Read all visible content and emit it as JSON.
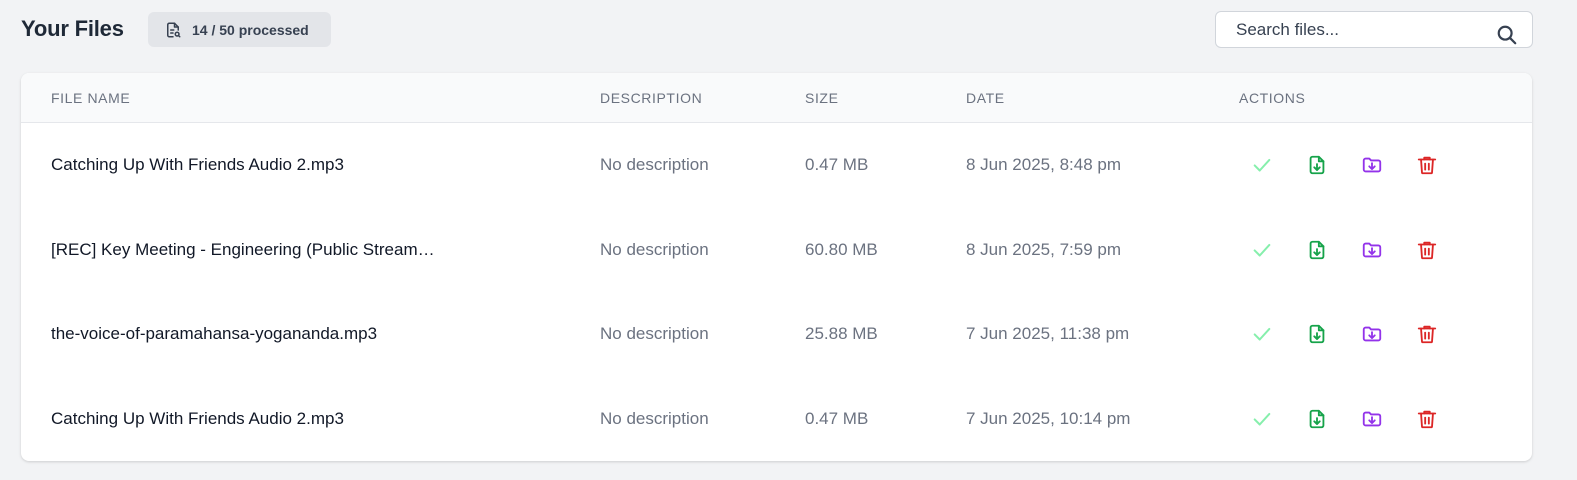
{
  "header": {
    "title": "Your Files",
    "badge": {
      "icon": "file-list-icon",
      "text": "14 / 50 processed"
    },
    "search": {
      "placeholder": "Search files...",
      "value": "",
      "icon": "search-icon"
    }
  },
  "table": {
    "columns": [
      "File Name",
      "Description",
      "Size",
      "Date",
      "Actions"
    ],
    "rows": [
      {
        "name": "Catching Up With Friends Audio 2.mp3",
        "description": "No description",
        "size": "0.47 MB",
        "date": "8 Jun 2025, 8:48 pm"
      },
      {
        "name": "[REC] Key Meeting - Engineering (Public Stream…",
        "description": "No description",
        "size": "60.80 MB",
        "date": "8 Jun 2025, 7:59 pm"
      },
      {
        "name": "the-voice-of-paramahansa-yogananda.mp3",
        "description": "No description",
        "size": "25.88 MB",
        "date": "7 Jun 2025, 11:38 pm"
      },
      {
        "name": "Catching Up With Friends Audio 2.mp3",
        "description": "No description",
        "size": "0.47 MB",
        "date": "7 Jun 2025, 10:14 pm"
      }
    ],
    "action_icons": [
      "check-icon",
      "file-download-icon",
      "folder-download-icon",
      "trash-icon"
    ]
  },
  "colors": {
    "check": "#86efac",
    "file_download": "#16a34a",
    "folder_download": "#9333ea",
    "delete": "#dc2626"
  }
}
